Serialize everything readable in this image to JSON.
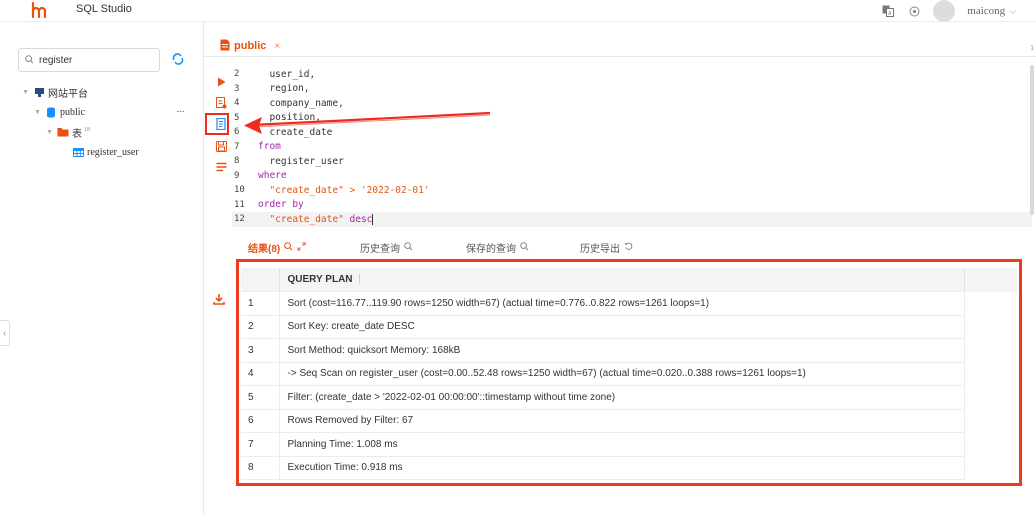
{
  "app": {
    "title": "SQL Studio",
    "user_name": "maicong",
    "brand_color": "#e8520f"
  },
  "sidebar": {
    "search_value": "register",
    "tree": [
      {
        "label": "网站平台",
        "icon": "platform-icon",
        "level": 0
      },
      {
        "label": "public",
        "icon": "database-icon",
        "level": 1
      },
      {
        "label": "表",
        "count": "18",
        "icon": "folder-icon",
        "level": 2
      },
      {
        "label": "register_user",
        "icon": "table-icon",
        "level": 3
      }
    ]
  },
  "tab": {
    "label": "public",
    "close": "×",
    "edge_num": "1"
  },
  "editor": {
    "lines": [
      {
        "n": "2",
        "text": "  user_id,"
      },
      {
        "n": "3",
        "text": "  region,"
      },
      {
        "n": "4",
        "text": "  company_name,"
      },
      {
        "n": "5",
        "text": "  position,"
      },
      {
        "n": "6",
        "text": "  create_date"
      },
      {
        "n": "7",
        "kw": "from"
      },
      {
        "n": "8",
        "text": "  register_user"
      },
      {
        "n": "9",
        "kw": "where"
      },
      {
        "n": "10",
        "str": "  \"create_date\" > '2022-02-01'"
      },
      {
        "n": "11",
        "kw": "order by"
      },
      {
        "n": "12",
        "str": "  \"create_date\"",
        "kw2": " desc"
      }
    ]
  },
  "result_tabs": [
    {
      "label": "结果(8)",
      "icon": "search-icon",
      "icon2": "expand-icon"
    },
    {
      "label": "历史查询",
      "icon": "search-icon"
    },
    {
      "label": "保存的查询",
      "icon": "search-icon"
    },
    {
      "label": "历史导出",
      "icon": "refresh-icon"
    }
  ],
  "results": {
    "column": "QUERY PLAN",
    "rows": [
      {
        "idx": "1",
        "value": "Sort (cost=116.77..119.90 rows=1250 width=67) (actual time=0.776..0.822 rows=1261 loops=1)"
      },
      {
        "idx": "2",
        "value": "Sort Key: create_date DESC"
      },
      {
        "idx": "3",
        "value": "Sort Method: quicksort Memory: 168kB"
      },
      {
        "idx": "4",
        "value": "-> Seq Scan on register_user (cost=0.00..52.48 rows=1250 width=67) (actual time=0.020..0.388 rows=1261 loops=1)"
      },
      {
        "idx": "5",
        "value": "Filter: (create_date > '2022-02-01 00:00:00'::timestamp without time zone)"
      },
      {
        "idx": "6",
        "value": "Rows Removed by Filter: 67"
      },
      {
        "idx": "7",
        "value": "Planning Time: 1.008 ms"
      },
      {
        "idx": "8",
        "value": "Execution Time: 0.918 ms"
      }
    ]
  },
  "annotation_color": "#ee2b1e"
}
